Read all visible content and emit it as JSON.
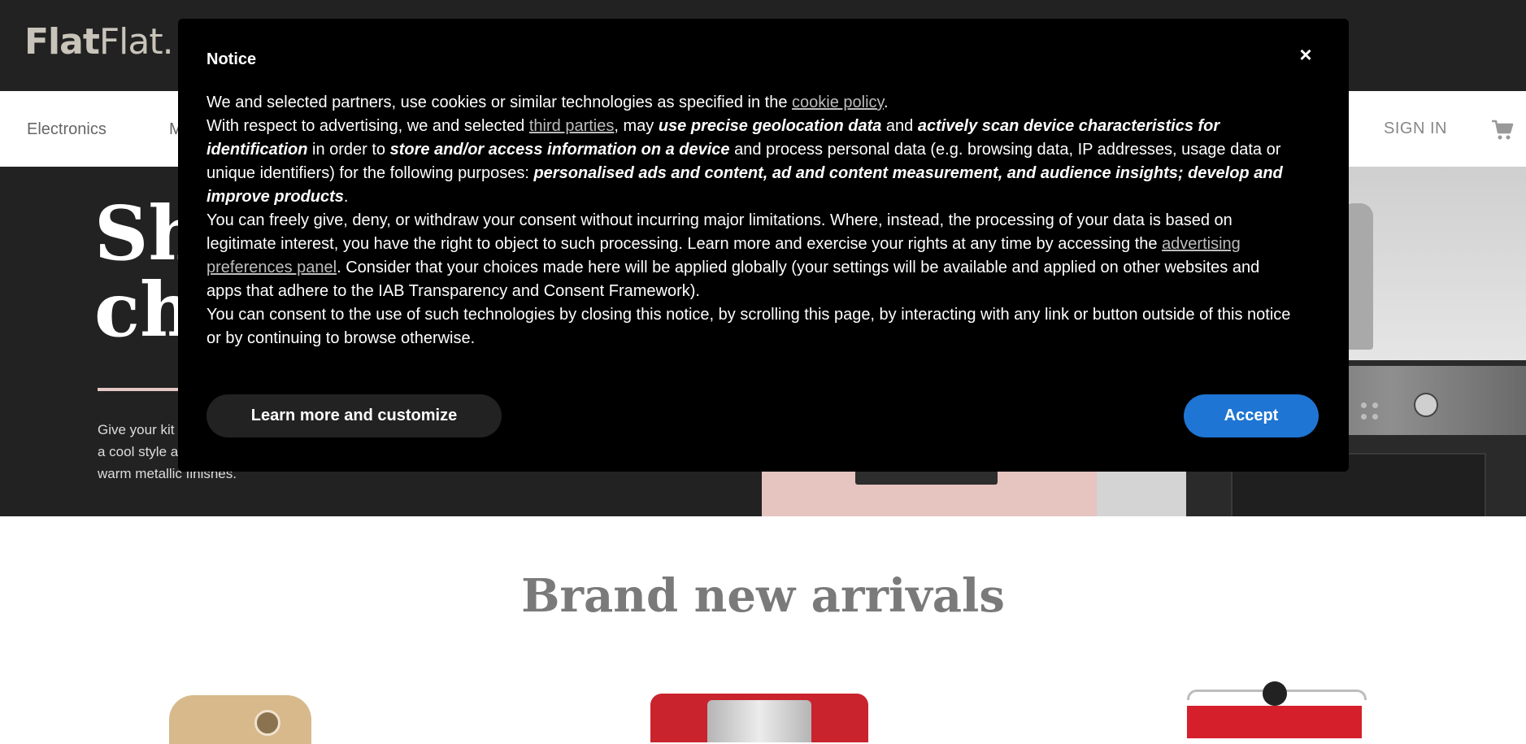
{
  "header": {
    "logo_bold": "Flat",
    "logo_thin": "Flat.",
    "nav": [
      "Electronics",
      "M"
    ],
    "signin": "SIGN IN",
    "cart_icon": "cart-icon"
  },
  "hero": {
    "title_line1": "Sh",
    "title_line2": "ch",
    "description_line1": "Give your kit",
    "description_line2": "a cool style a",
    "description_line3": "warm metallic finishes."
  },
  "section": {
    "title": "Brand new arrivals"
  },
  "notice": {
    "title": "Notice",
    "close_label": "×",
    "p1_text_before": "We and selected partners, use cookies or similar technologies as specified in the ",
    "p1_link": "cookie policy",
    "p1_text_after": ".",
    "p2_t1": "With respect to advertising, we and selected ",
    "p2_link": "third parties",
    "p2_t2": ", may ",
    "p2_e1": "use precise geolocation data",
    "p2_t3": " and ",
    "p2_e2": "actively scan device characteristics for identification",
    "p2_t4": " in order to ",
    "p2_e3": "store and/or access information on a device",
    "p2_t5": " and process personal data (e.g. browsing data, IP addresses, usage data or unique identifiers) for the following purposes: ",
    "p2_e4": "personalised ads and content, ad and content measurement, and audience insights; develop and improve products",
    "p2_t6": ".",
    "p3_t1": "You can freely give, deny, or withdraw your consent without incurring major limitations. Where, instead, the processing of your data is based on legitimate interest, you have the right to object to such processing. Learn more and exercise your rights at any time by accessing the ",
    "p3_link": "advertising preferences panel",
    "p3_t2": ". Consider that your choices made here will be applied globally (your settings will be available and applied on other websites and apps that adhere to the IAB Transparency and Consent Framework).",
    "p4": "You can consent to the use of such technologies by closing this notice, by scrolling this page, by interacting with any link or button outside of this notice or by continuing to browse otherwise.",
    "customize_button": "Learn more and customize",
    "accept_button": "Accept"
  },
  "colors": {
    "header_bg": "#222222",
    "modal_bg": "#000000",
    "accept_bg": "#1f75d3",
    "link": "#bdbdbd",
    "section_title": "#7a7a7a"
  }
}
